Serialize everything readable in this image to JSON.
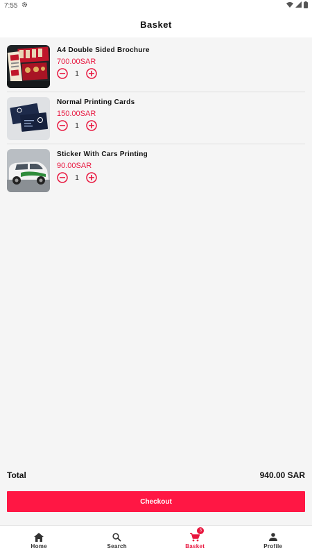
{
  "status_bar": {
    "time": "7:55"
  },
  "header": {
    "title": "Basket"
  },
  "items": [
    {
      "name": "A4 Double Sided Brochure",
      "price": "700.00SAR",
      "quantity": "1"
    },
    {
      "name": "Normal Printing Cards",
      "price": "150.00SAR",
      "quantity": "1"
    },
    {
      "name": "Sticker With Cars Printing",
      "price": "90.00SAR",
      "quantity": "1"
    }
  ],
  "summary": {
    "total_label": "Total",
    "total_value": "940.00 SAR"
  },
  "checkout": {
    "label": "Checkout"
  },
  "nav": {
    "home": "Home",
    "search": "Search",
    "basket": "Basket",
    "basket_badge": "3",
    "profile": "Profile"
  },
  "colors": {
    "accent": "#e8173f",
    "checkout_bg": "#ff1744"
  }
}
